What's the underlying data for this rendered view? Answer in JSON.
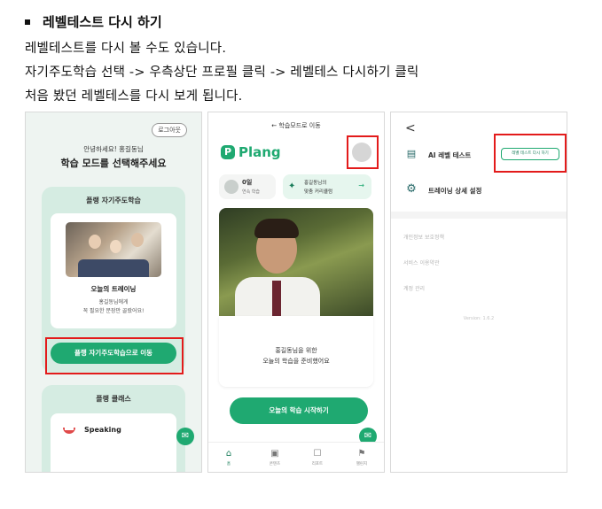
{
  "doc": {
    "heading": "레벨테스트 다시 하기",
    "lines": [
      "레벨테스트를 다시 볼 수도 있습니다.",
      "자기주도학습 선택 -> 우측상단 프로필 클릭 -> 레벨테스 다시하기 클릭",
      "처음 봤던 레벨테스를 다시 보게 됩니다."
    ]
  },
  "screen1": {
    "logout": "로그아웃",
    "greeting": "안녕하세요! 홍길동님",
    "title": "학습 모드를 선택해주세요",
    "card1_title": "플랭 자기주도학습",
    "today_title": "오늘의 트레이닝",
    "today_sub1": "홍길동님에게",
    "today_sub2": "꼭 필요한 문장만 골랐어요!",
    "move_button": "플랭 자기주도학습으로 이동",
    "card2_title": "플랭 클래스",
    "speaking": "Speaking",
    "chat_icon": "chat-bubble-icon"
  },
  "screen2": {
    "top_nav": "← 학습모드로 이동",
    "logo_mark": "P",
    "logo_text": "Plang",
    "streak_value": "0일",
    "streak_label": "연속 학습",
    "curriculum_line1": "홍길동님의",
    "curriculum_line2": "맞춤 커리큘럼",
    "curriculum_arrow": "→",
    "hero_line1": "홍길동님을 위한",
    "hero_line2": "오늘의 학습을 준비했어요",
    "start_button": "오늘의 학습 시작하기",
    "tabs": [
      {
        "icon": "⌂",
        "label": "홈"
      },
      {
        "icon": "▣",
        "label": "콘텐츠"
      },
      {
        "icon": "☐",
        "label": "리포트"
      },
      {
        "icon": "⚑",
        "label": "챌린지"
      }
    ]
  },
  "screen3": {
    "back": "<",
    "row1_label": "AI 레벨 테스트",
    "retest_button": "레벨 테스트 다시 하기",
    "row2_label": "트레이닝 상세 설정",
    "links": [
      "개인정보 보호정책",
      "서비스 이용약관",
      "계정 관리"
    ],
    "version": "Version: 1.6.2"
  },
  "colors": {
    "brand_green": "#1fa971",
    "highlight_red": "#e31b1b"
  }
}
